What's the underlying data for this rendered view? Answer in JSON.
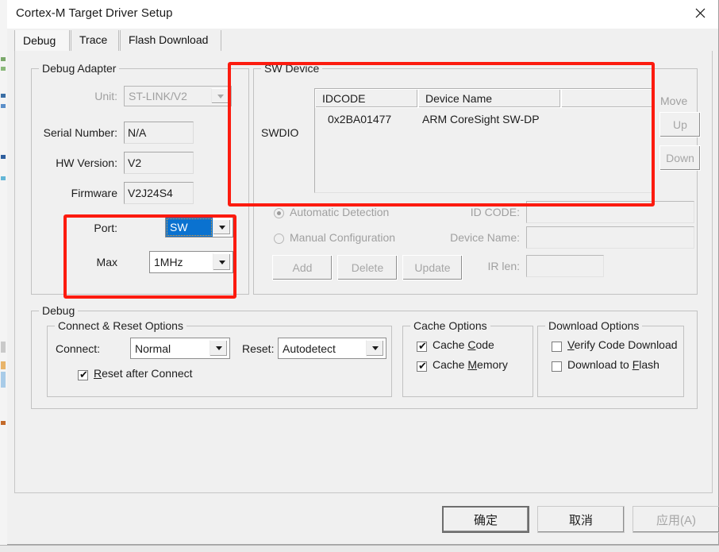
{
  "window": {
    "title": "Cortex-M Target Driver Setup",
    "close_icon": "close-icon"
  },
  "tabs": [
    {
      "label": "Debug",
      "active": true
    },
    {
      "label": "Trace",
      "active": false
    },
    {
      "label": "Flash Download",
      "active": false
    }
  ],
  "debug_adapter": {
    "legend": "Debug Adapter",
    "unit": {
      "label": "Unit:",
      "value": "ST-LINK/V2",
      "disabled": true
    },
    "serial_number": {
      "label": "Serial Number:",
      "value": "N/A"
    },
    "hw_version": {
      "label": "HW Version:",
      "value": "V2"
    },
    "firmware": {
      "label": "Firmware",
      "value": "V2J24S4"
    },
    "port": {
      "label": "Port:",
      "value": "SW",
      "focused": true
    },
    "max": {
      "label": "Max",
      "value": "1MHz"
    }
  },
  "sw_device": {
    "legend": "SW Device",
    "bus_label": "SWDIO",
    "columns": [
      "IDCODE",
      "Device Name",
      ""
    ],
    "rows": [
      {
        "idcode": "0x2BA01477",
        "device_name": "ARM CoreSight SW-DP"
      }
    ],
    "move": {
      "label": "Move",
      "up": "Up",
      "down": "Down"
    },
    "detection": {
      "automatic": "Automatic Detection",
      "manual": "Manual Configuration",
      "selected": "automatic"
    },
    "id_code": {
      "label": "ID CODE:",
      "value": ""
    },
    "device_name": {
      "label": "Device Name:",
      "value": ""
    },
    "ir_len": {
      "label": "IR len:",
      "value": ""
    },
    "buttons": {
      "add": "Add",
      "delete": "Delete",
      "update": "Update"
    }
  },
  "debug": {
    "legend": "Debug",
    "connect_reset": {
      "legend": "Connect & Reset Options",
      "connect": {
        "label": "Connect:",
        "value": "Normal"
      },
      "reset": {
        "label": "Reset:",
        "value": "Autodetect"
      },
      "reset_after_connect": {
        "label": "Reset after Connect",
        "checked": true
      }
    },
    "cache_options": {
      "legend": "Cache Options",
      "cache_code": {
        "label": "Cache Code",
        "checked": true
      },
      "cache_memory": {
        "label": "Cache Memory",
        "checked": true
      }
    },
    "download_options": {
      "legend": "Download Options",
      "verify_code_download": {
        "label": "Verify Code Download",
        "checked": false
      },
      "download_to_flash": {
        "label": "Download to Flash",
        "checked": false
      }
    }
  },
  "footer": {
    "ok": "确定",
    "cancel": "取消",
    "apply": "应用(A)",
    "apply_disabled": true
  },
  "annotations": {
    "highlight_color": "#fc1b0f",
    "boxes": [
      {
        "name": "sw-device-highlight"
      },
      {
        "name": "port-max-highlight"
      }
    ]
  }
}
